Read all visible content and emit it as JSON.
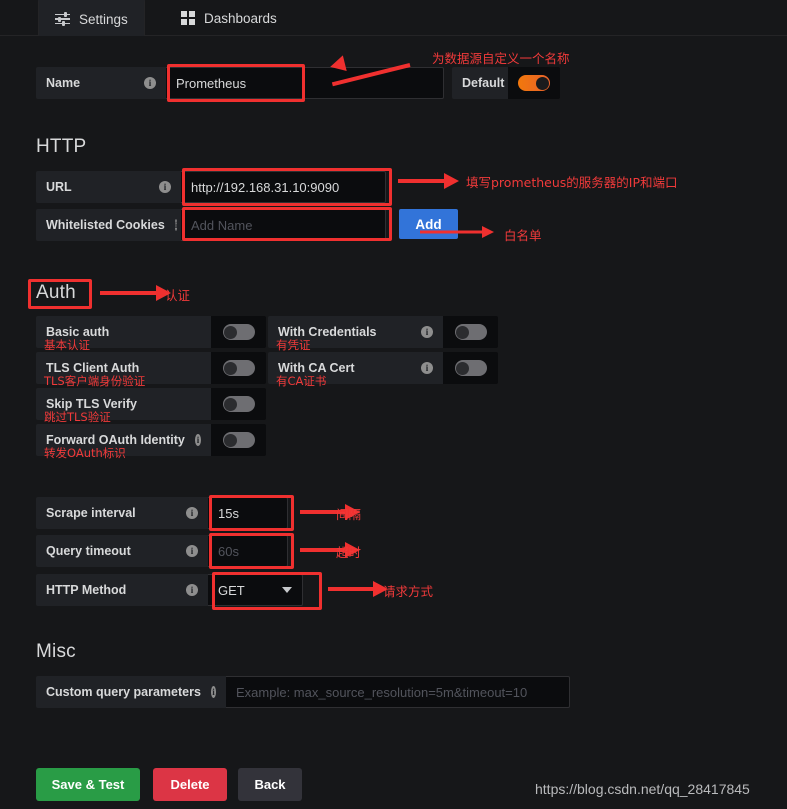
{
  "tabs": [
    {
      "label": "Settings",
      "icon": "sliders-icon",
      "active": true
    },
    {
      "label": "Dashboards",
      "icon": "grid-icon",
      "active": false
    }
  ],
  "name_row": {
    "label": "Name",
    "value": "Prometheus",
    "default_label": "Default",
    "default_on": true,
    "annotation": "为数据源自定义一个名称"
  },
  "http": {
    "title": "HTTP",
    "url": {
      "label": "URL",
      "value": "http://192.168.31.10:9090",
      "annotation": "填写prometheus的服务器的IP和端口"
    },
    "cookies": {
      "label": "Whitelisted Cookies",
      "placeholder": "Add Name",
      "add_button": "Add",
      "annotation": "白名单"
    }
  },
  "auth": {
    "title": "Auth",
    "annotation": "认证",
    "left": [
      {
        "label": "Basic auth",
        "sub": "基本认证",
        "on": false,
        "info": false
      },
      {
        "label": "TLS Client Auth",
        "sub": "TLS客户端身份验证",
        "on": false,
        "info": false
      },
      {
        "label": "Skip TLS Verify",
        "sub": "跳过TLS验证",
        "on": false,
        "info": false
      },
      {
        "label": "Forward OAuth Identity",
        "sub": "转发OAuth标识",
        "on": false,
        "info": true
      }
    ],
    "right": [
      {
        "label": "With Credentials",
        "sub": "有凭证",
        "on": false,
        "info": true
      },
      {
        "label": "With CA Cert",
        "sub": "有CA证书",
        "on": false,
        "info": true
      }
    ]
  },
  "settings_rows": [
    {
      "label": "Scrape interval",
      "value": "15s",
      "placeholder": "",
      "annotation": "间隔",
      "type": "text"
    },
    {
      "label": "Query timeout",
      "value": "",
      "placeholder": "60s",
      "annotation": "超时",
      "type": "text"
    },
    {
      "label": "HTTP Method",
      "value": "GET",
      "placeholder": "",
      "annotation": "请求方式",
      "type": "select"
    }
  ],
  "misc": {
    "title": "Misc",
    "custom_query": {
      "label": "Custom query parameters",
      "placeholder": "Example: max_source_resolution=5m&timeout=10"
    }
  },
  "footer": {
    "save": "Save & Test",
    "delete": "Delete",
    "back": "Back",
    "watermark": "https://blog.csdn.net/qq_28417845"
  },
  "colors": {
    "accent_orange": "#f2780c",
    "annotation_red": "#f0302f",
    "primary_blue": "#3274d9",
    "success_green": "#299c46",
    "danger_red": "#dc3545",
    "panel_bg": "#202226",
    "page_bg": "#161719",
    "input_bg": "#0b0c0e"
  }
}
